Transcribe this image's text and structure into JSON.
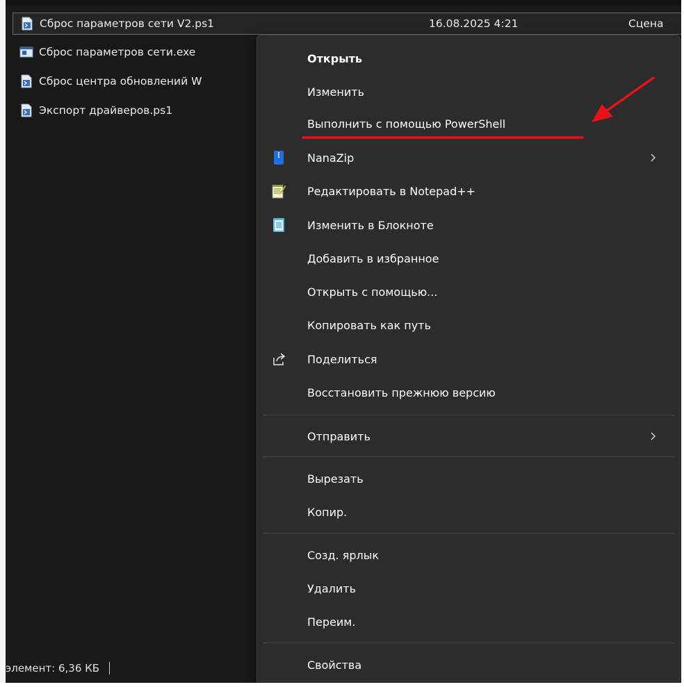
{
  "files": [
    {
      "name": "Сброс параметров сети V2.ps1",
      "date": "16.08.2025 4:21",
      "type": "Сцена",
      "icon": "powershell-script-icon",
      "selected": true
    },
    {
      "name": "Сброс параметров сети.exe",
      "date": "",
      "type": "",
      "icon": "exe-icon",
      "selected": false
    },
    {
      "name": "Сброс центра обновлений W",
      "date": "",
      "type": "",
      "icon": "powershell-script-icon",
      "selected": false
    },
    {
      "name": "Экспорт драйверов.ps1",
      "date": "",
      "type": "",
      "icon": "powershell-script-icon",
      "selected": false
    }
  ],
  "status_bar": {
    "text": "элемент: 6,36 КБ"
  },
  "context_menu": {
    "items": [
      {
        "label": "Открыть",
        "bold": true,
        "icon": "",
        "submenu": false
      },
      {
        "label": "Изменить",
        "bold": false,
        "icon": "",
        "submenu": false
      },
      {
        "label": "Выполнить с помощью PowerShell",
        "bold": false,
        "icon": "",
        "submenu": false,
        "highlighted_by_annotation": true
      },
      {
        "label": "NanaZip",
        "bold": false,
        "icon": "nanazip-archive-icon",
        "submenu": true
      },
      {
        "label": "Редактировать в Notepad++",
        "bold": false,
        "icon": "notepad-plus-plus-icon",
        "submenu": false
      },
      {
        "label": "Изменить в Блокноте",
        "bold": false,
        "icon": "notepad-icon",
        "submenu": false
      },
      {
        "label": "Добавить в избранное",
        "bold": false,
        "icon": "",
        "submenu": false
      },
      {
        "label": "Открыть с помощью...",
        "bold": false,
        "icon": "",
        "submenu": false
      },
      {
        "label": "Копировать как путь",
        "bold": false,
        "icon": "",
        "submenu": false
      },
      {
        "label": "Поделиться",
        "bold": false,
        "icon": "share-icon",
        "submenu": false
      },
      {
        "label": "Восстановить прежнюю версию",
        "bold": false,
        "icon": "",
        "submenu": false
      },
      {
        "label": "Отправить",
        "bold": false,
        "icon": "",
        "submenu": true
      },
      {
        "label": "Вырезать",
        "bold": false,
        "icon": "",
        "submenu": false
      },
      {
        "label": "Копир.",
        "bold": false,
        "icon": "",
        "submenu": false
      },
      {
        "label": "Созд. ярлык",
        "bold": false,
        "icon": "",
        "submenu": false
      },
      {
        "label": "Удалить",
        "bold": false,
        "icon": "",
        "submenu": false
      },
      {
        "label": "Переим.",
        "bold": false,
        "icon": "",
        "submenu": false
      },
      {
        "label": "Свойства",
        "bold": false,
        "icon": "",
        "submenu": false
      }
    ]
  },
  "colors": {
    "background": "#191919",
    "menu_background": "#2c2c2c",
    "text": "#ffffff",
    "annotation": "#e8121a"
  }
}
